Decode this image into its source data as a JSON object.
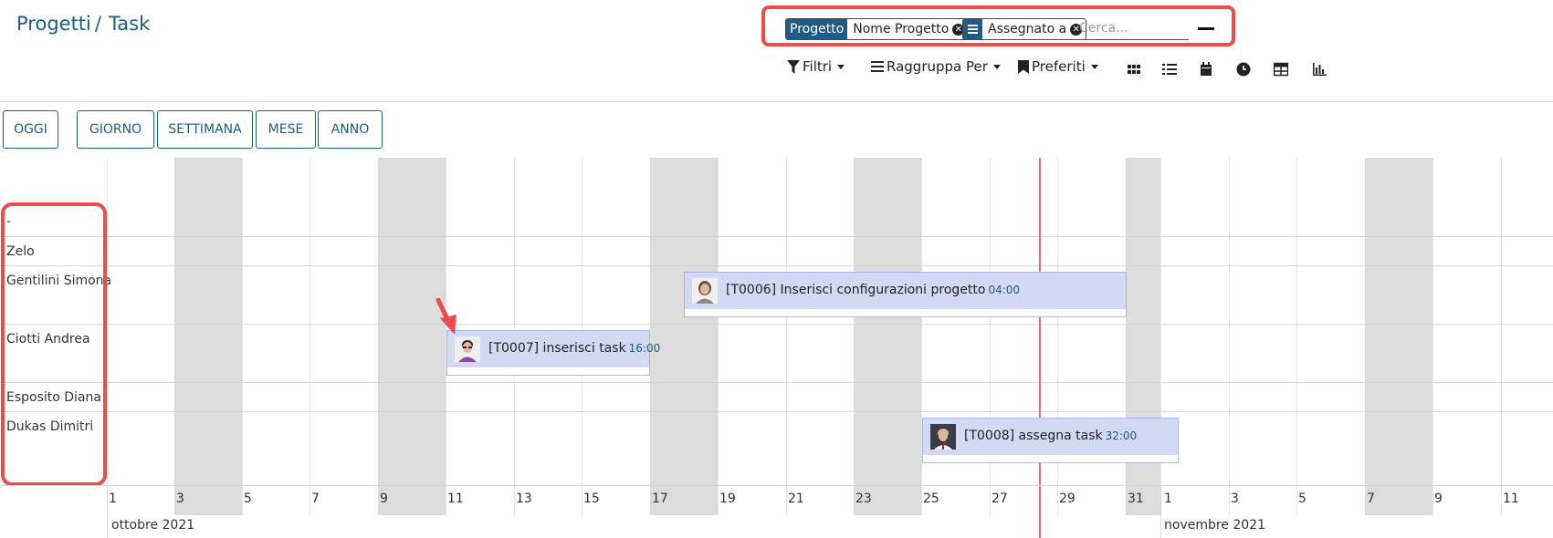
{
  "breadcrumb": {
    "parent": "Progetti",
    "separator": "/",
    "current": "Task"
  },
  "search": {
    "facets": [
      {
        "tag": "Progetto",
        "value": "Nome Progetto"
      },
      {
        "tag_icon": "list-icon",
        "value": "Assegnato a"
      }
    ],
    "placeholder": "Cerca...",
    "remove_icon": "close-icon"
  },
  "toolbar": {
    "filters": "Filtri",
    "group_by": "Raggruppa Per",
    "favorites": "Preferiti",
    "views": [
      "kanban-icon",
      "list-icon",
      "calendar-icon",
      "activity-icon",
      "pivot-icon",
      "graph-icon"
    ]
  },
  "scales": {
    "today": "OGGI",
    "day": "GIORNO",
    "week": "SETTIMANA",
    "month": "MESE",
    "year": "ANNO"
  },
  "rows": [
    {
      "label": "-"
    },
    {
      "label": "Zelo"
    },
    {
      "label": "Gentilini Simona"
    },
    {
      "label": "Ciotti Andrea"
    },
    {
      "label": "Esposito Diana"
    },
    {
      "label": "Dukas Dimitri"
    }
  ],
  "tasks": [
    {
      "name": "[T0006] Inserisci configurazioni progetto",
      "hours": "04:00",
      "row": "Gentilini Simona",
      "avatar": "woman-avatar"
    },
    {
      "name": "[T0007] inserisci task",
      "hours": "16:00",
      "row": "Ciotti Andrea",
      "avatar": "man-glasses-avatar"
    },
    {
      "name": "[T0008] assegna task",
      "hours": "32:00",
      "row": "Dukas Dimitri",
      "avatar": "man-grey-avatar"
    }
  ],
  "timeline": {
    "day_labels": [
      "1",
      "3",
      "5",
      "7",
      "9",
      "11",
      "13",
      "15",
      "17",
      "19",
      "21",
      "23",
      "25",
      "27",
      "29",
      "31",
      "1",
      "3",
      "5",
      "7",
      "9",
      "11"
    ],
    "months": [
      "ottobre 2021",
      "novembre 2021"
    ]
  },
  "colors": {
    "primary": "#1c5c86",
    "highlight": "#ee4b4b",
    "task_bar": "#d1d9f3",
    "weekend": "#dcdcdc",
    "today_line": "#ee6b6b"
  }
}
